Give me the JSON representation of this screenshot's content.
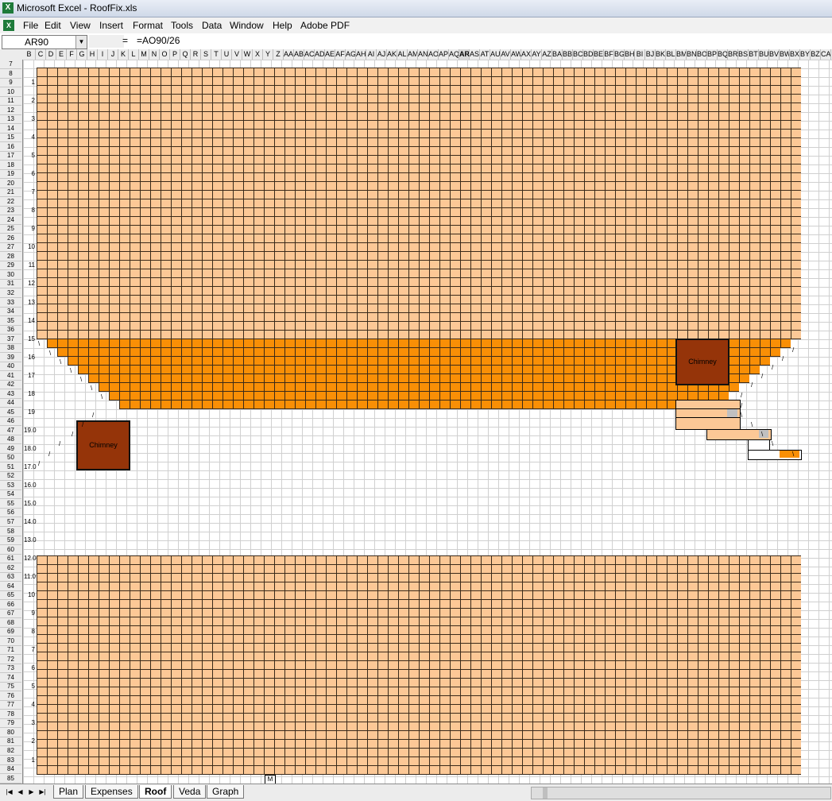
{
  "window": {
    "title": "Microsoft Excel - RoofFix.xls"
  },
  "menu": [
    "File",
    "Edit",
    "View",
    "Insert",
    "Format",
    "Tools",
    "Data",
    "Window",
    "Help",
    "Adobe PDF"
  ],
  "formula_bar": {
    "name_box": "AR90",
    "equals": "=",
    "formula": "=AO90/26"
  },
  "columns": [
    "B",
    "C",
    "D",
    "E",
    "F",
    "G",
    "H",
    "I",
    "J",
    "K",
    "L",
    "M",
    "N",
    "O",
    "P",
    "Q",
    "R",
    "S",
    "T",
    "U",
    "V",
    "W",
    "X",
    "Y",
    "Z",
    "AA",
    "AB",
    "AC",
    "AD",
    "AE",
    "AF",
    "AG",
    "AH",
    "AI",
    "AJ",
    "AK",
    "AL",
    "AM",
    "AN",
    "AO",
    "AP",
    "AQ",
    "AR",
    "AS",
    "AT",
    "AU",
    "AV",
    "AW",
    "AX",
    "AY",
    "AZ",
    "BA",
    "BB",
    "BC",
    "BD",
    "BE",
    "BF",
    "BG",
    "BH",
    "BI",
    "BJ",
    "BK",
    "BL",
    "BM",
    "BN",
    "BO",
    "BP",
    "BQ",
    "BR",
    "BS",
    "BT",
    "BU",
    "BV",
    "BW",
    "BX",
    "BY",
    "BZ",
    "CA"
  ],
  "rows_first": 7,
  "rows_last": 85,
  "y_labels": [
    {
      "row": 9,
      "text": "1"
    },
    {
      "row": 11,
      "text": "2"
    },
    {
      "row": 13,
      "text": "3"
    },
    {
      "row": 15,
      "text": "4"
    },
    {
      "row": 17,
      "text": "5"
    },
    {
      "row": 19,
      "text": "6"
    },
    {
      "row": 21,
      "text": "7"
    },
    {
      "row": 23,
      "text": "8"
    },
    {
      "row": 25,
      "text": "9"
    },
    {
      "row": 27,
      "text": "10"
    },
    {
      "row": 29,
      "text": "11"
    },
    {
      "row": 31,
      "text": "12"
    },
    {
      "row": 33,
      "text": "13"
    },
    {
      "row": 35,
      "text": "14"
    },
    {
      "row": 37,
      "text": "15"
    },
    {
      "row": 39,
      "text": "16"
    },
    {
      "row": 41,
      "text": "17"
    },
    {
      "row": 43,
      "text": "18"
    },
    {
      "row": 45,
      "text": "19"
    },
    {
      "row": 47,
      "text": "19.0"
    },
    {
      "row": 49,
      "text": "18.0"
    },
    {
      "row": 51,
      "text": "17.0"
    },
    {
      "row": 53,
      "text": "16.0"
    },
    {
      "row": 55,
      "text": "15.0"
    },
    {
      "row": 57,
      "text": "14.0"
    },
    {
      "row": 59,
      "text": "13.0"
    },
    {
      "row": 61,
      "text": "12.0"
    },
    {
      "row": 63,
      "text": "11.0"
    },
    {
      "row": 65,
      "text": "10"
    },
    {
      "row": 67,
      "text": "9"
    },
    {
      "row": 69,
      "text": "8"
    },
    {
      "row": 71,
      "text": "7"
    },
    {
      "row": 73,
      "text": "6"
    },
    {
      "row": 75,
      "text": "5"
    },
    {
      "row": 77,
      "text": "4"
    },
    {
      "row": 79,
      "text": "3"
    },
    {
      "row": 81,
      "text": "2"
    },
    {
      "row": 83,
      "text": "1"
    }
  ],
  "chimneys": [
    {
      "label": "Chimney"
    },
    {
      "label": "Chimney"
    }
  ],
  "cell_m85": "M",
  "sheet_tabs": [
    "Plan",
    "Expenses",
    "Roof",
    "Veda",
    "Graph"
  ],
  "active_tab": "Roof",
  "colors": {
    "light_brick": "#fcc896",
    "orange_brick": "#f98f06",
    "chimney": "#953409"
  }
}
